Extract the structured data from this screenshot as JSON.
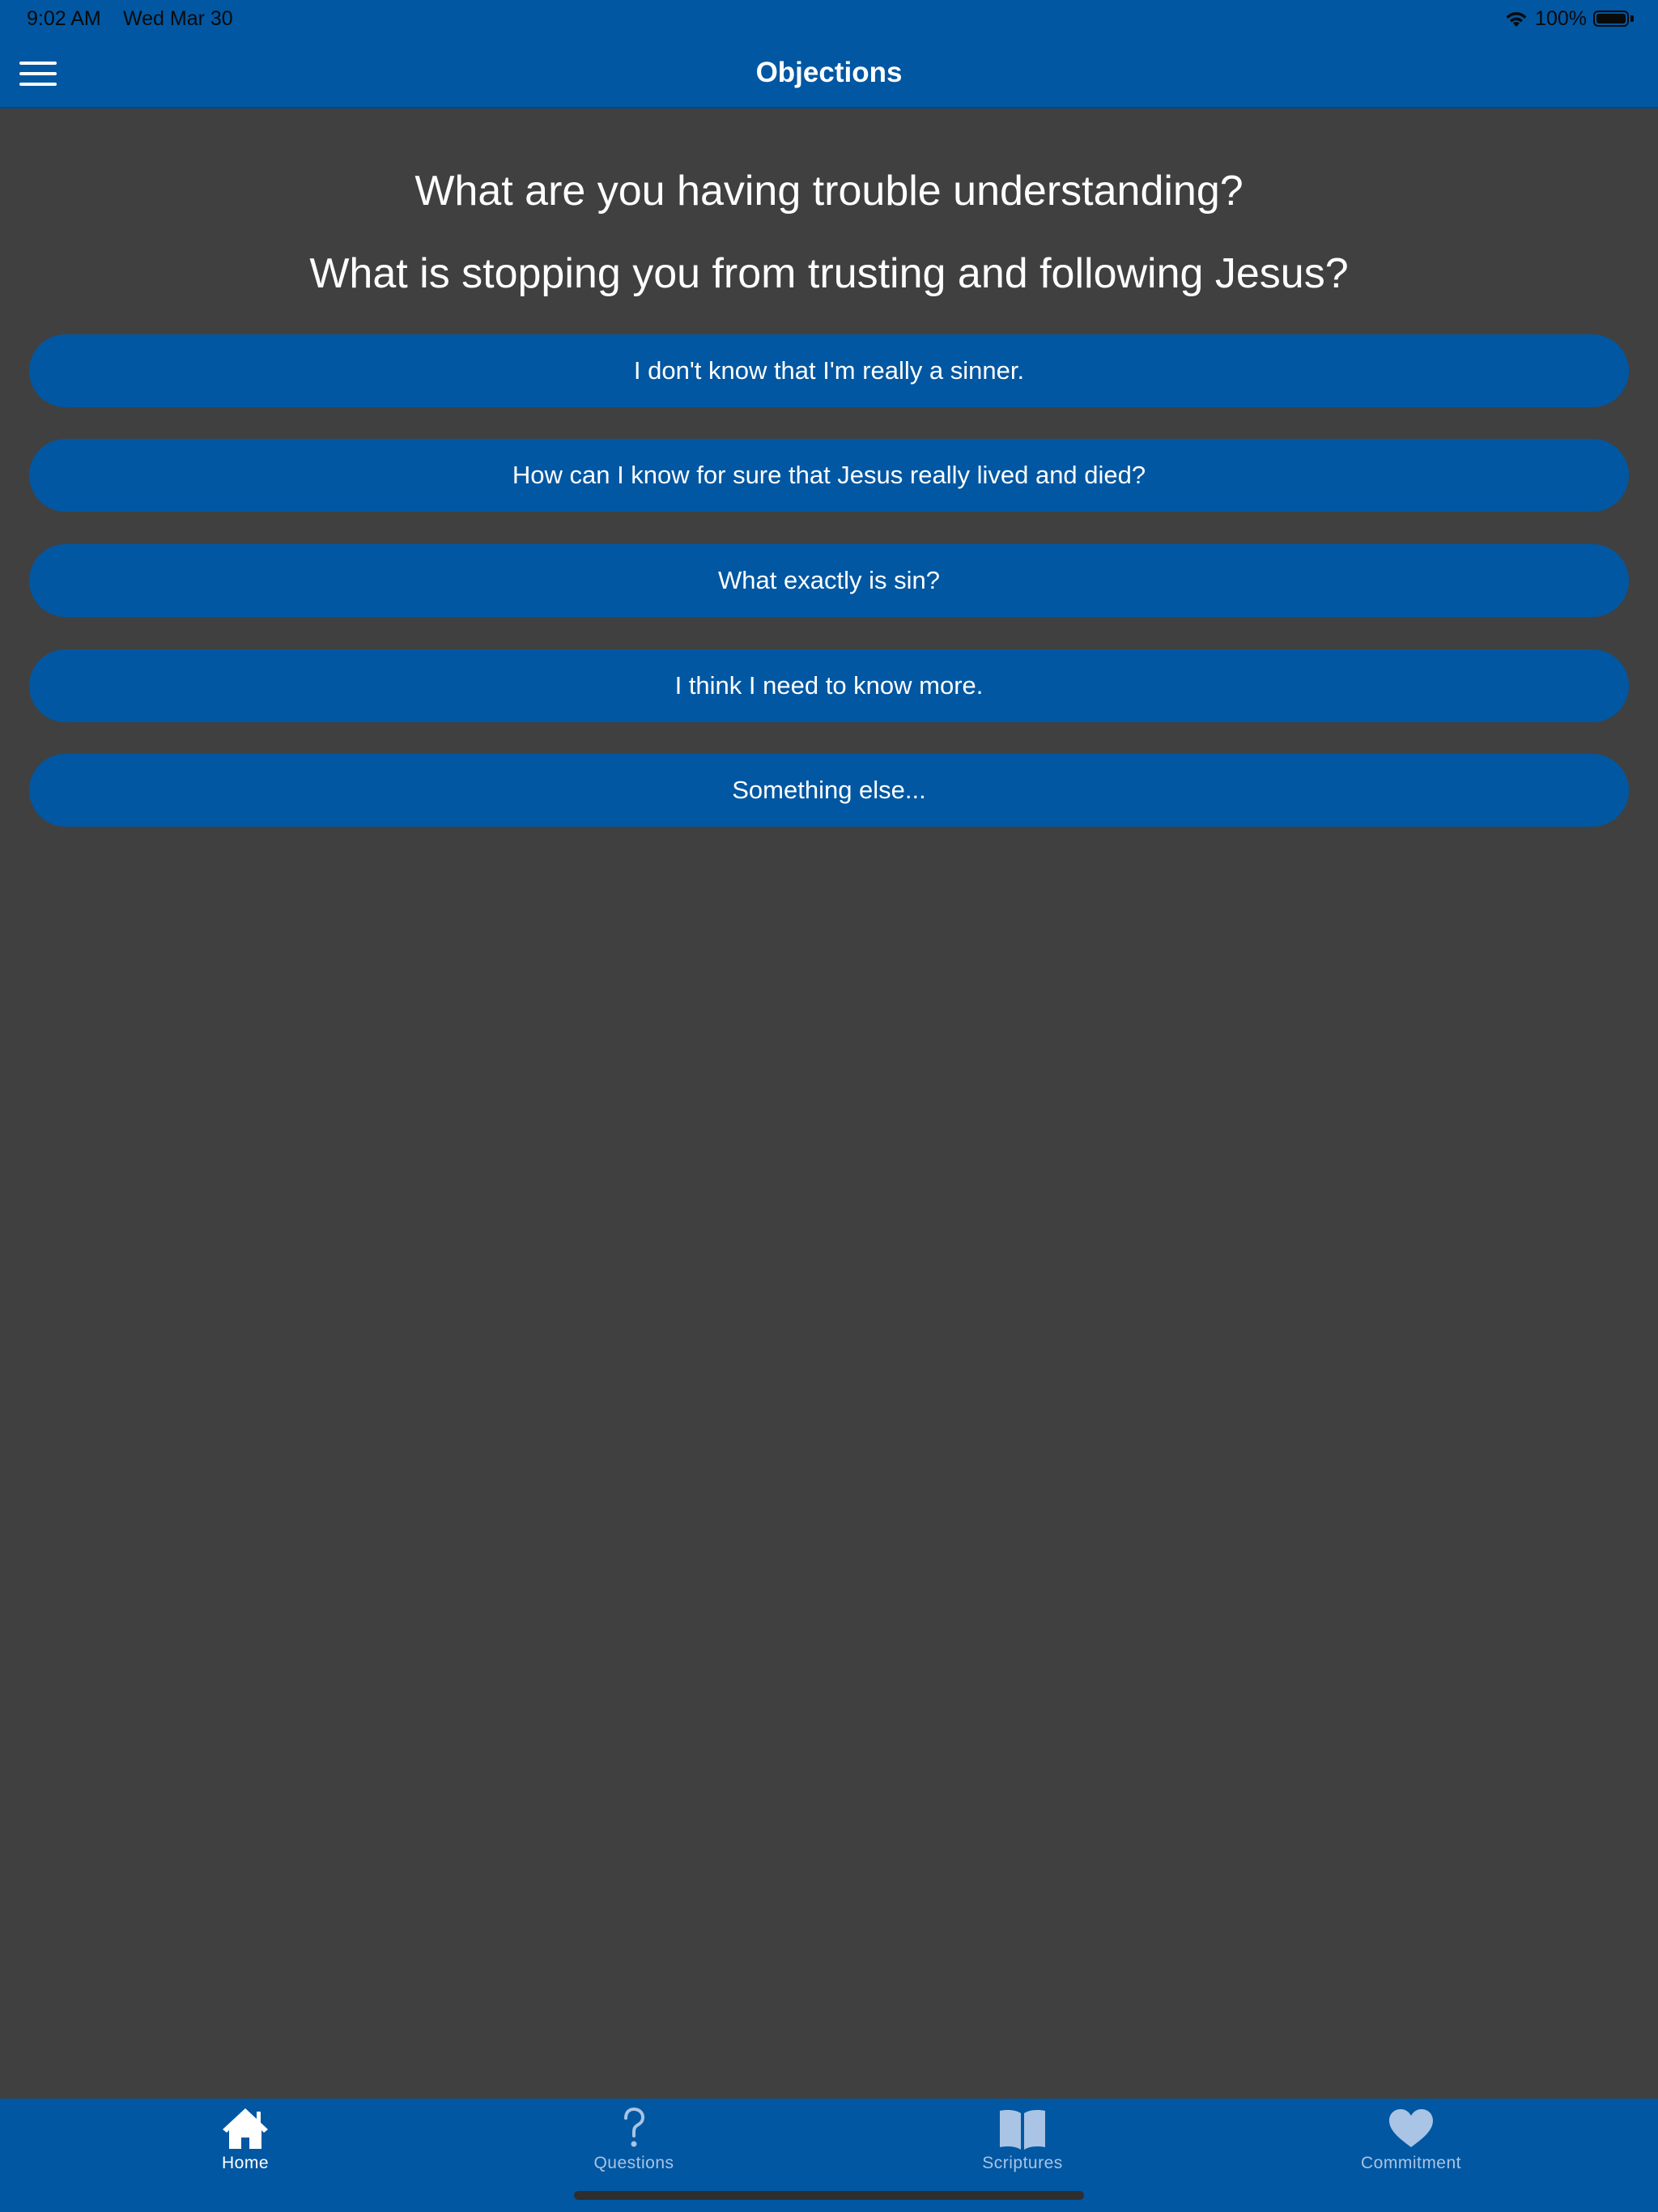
{
  "status_bar": {
    "time": "9:02 AM",
    "date": "Wed Mar 30",
    "battery": "100%"
  },
  "nav": {
    "title": "Objections",
    "menu_icon": "hamburger-menu-icon"
  },
  "main": {
    "heading_1": "What are you having trouble understanding?",
    "heading_2": "What is stopping you from trusting and following Jesus?",
    "options": [
      {
        "label": "I don't know that I'm really a sinner."
      },
      {
        "label": "How can I know for sure that Jesus really lived and died?"
      },
      {
        "label": "What exactly is sin?"
      },
      {
        "label": "I think I need to know more."
      },
      {
        "label": "Something else..."
      }
    ]
  },
  "tabs": [
    {
      "label": "Home",
      "icon": "home-icon",
      "active": true
    },
    {
      "label": "Questions",
      "icon": "question-mark-icon",
      "active": false
    },
    {
      "label": "Scriptures",
      "icon": "book-icon",
      "active": false
    },
    {
      "label": "Commitment",
      "icon": "heart-icon",
      "active": false
    }
  ],
  "colors": {
    "brand_blue": "#0157a2",
    "background": "#404040",
    "inactive_tab": "#a9c4e4"
  }
}
